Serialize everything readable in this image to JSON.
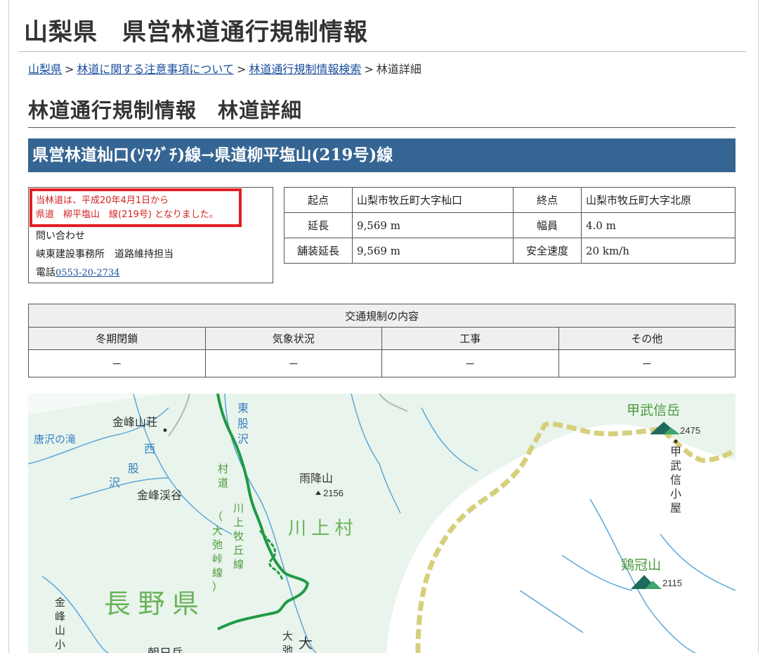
{
  "site_title": "山梨県　県営林道通行規制情報",
  "breadcrumb": {
    "items": [
      "山梨県",
      "林道に関する注意事項について",
      "林道通行規制情報検索"
    ],
    "current": "林道詳細",
    "separator": ">"
  },
  "page_title": "林道通行規制情報　林道詳細",
  "road_name": "県営林道杣口(ｿﾏｸﾞﾁ)線→県道柳平塩山(219号)線",
  "notice": {
    "line1": "当林道は、平成20年4月1日から",
    "line2": "県道　柳平塩山　線(219号) となりました。"
  },
  "contact": {
    "label": "問い合わせ",
    "office": "峡東建設事務所　道路維持担当",
    "phone_label": "電話",
    "phone": "0553-20-2734"
  },
  "info": {
    "start_label": "起点",
    "start_value": "山梨市牧丘町大字杣口",
    "end_label": "終点",
    "end_value": "山梨市牧丘町大字北原",
    "length_label": "延長",
    "length_value": "9,569 m",
    "width_label": "幅員",
    "width_value": "4.0 m",
    "paved_label": "舗装延長",
    "paved_value": "9,569 m",
    "speed_label": "安全速度",
    "speed_value": "20 km/h"
  },
  "regulation": {
    "caption": "交通規制の内容",
    "headers": [
      "冬期閉鎖",
      "気象状況",
      "工事",
      "その他"
    ],
    "values": [
      "－",
      "－",
      "－",
      "－"
    ]
  },
  "map": {
    "labels": {
      "karasawa": "唐沢の滝",
      "kinpu_sanso": "金峰山荘",
      "nishimata_v": [
        "西",
        "股",
        "沢"
      ],
      "kinpu_keikoku": "金峰渓谷",
      "higashimata_v": [
        "東",
        "股",
        "沢"
      ],
      "sonmichi_v": [
        "村",
        "道"
      ],
      "kawakami_makioka_v": [
        "川",
        "上",
        "牧",
        "丘",
        "線"
      ],
      "oike_v": [
        "（",
        "大",
        "弛",
        "峠",
        "線",
        "）"
      ],
      "amafuri": "雨降山",
      "amafuri_elev": "2156",
      "kawakami_village": "川 上 村",
      "nagano": "長 野 県",
      "kobushi": "甲武信岳",
      "kobushi_elev": "2475",
      "kobushi_hut_v": [
        "甲",
        "武",
        "信",
        "小",
        "屋"
      ],
      "keikan": "鶏冠山",
      "keikan_elev": "2115",
      "kinpu_hut_v": [
        "金",
        "峰",
        "山",
        "小"
      ],
      "chougo": "朝日岳",
      "daikouchi_v": [
        "大",
        "弛"
      ],
      "dai": "大"
    },
    "colors": {
      "land": "#e9f4ec",
      "lowland": "#ffffff",
      "river": "#5aa8db",
      "road": "#1f9a45",
      "border": "#d6cf7c",
      "text_green": "#4a9a3a"
    }
  }
}
